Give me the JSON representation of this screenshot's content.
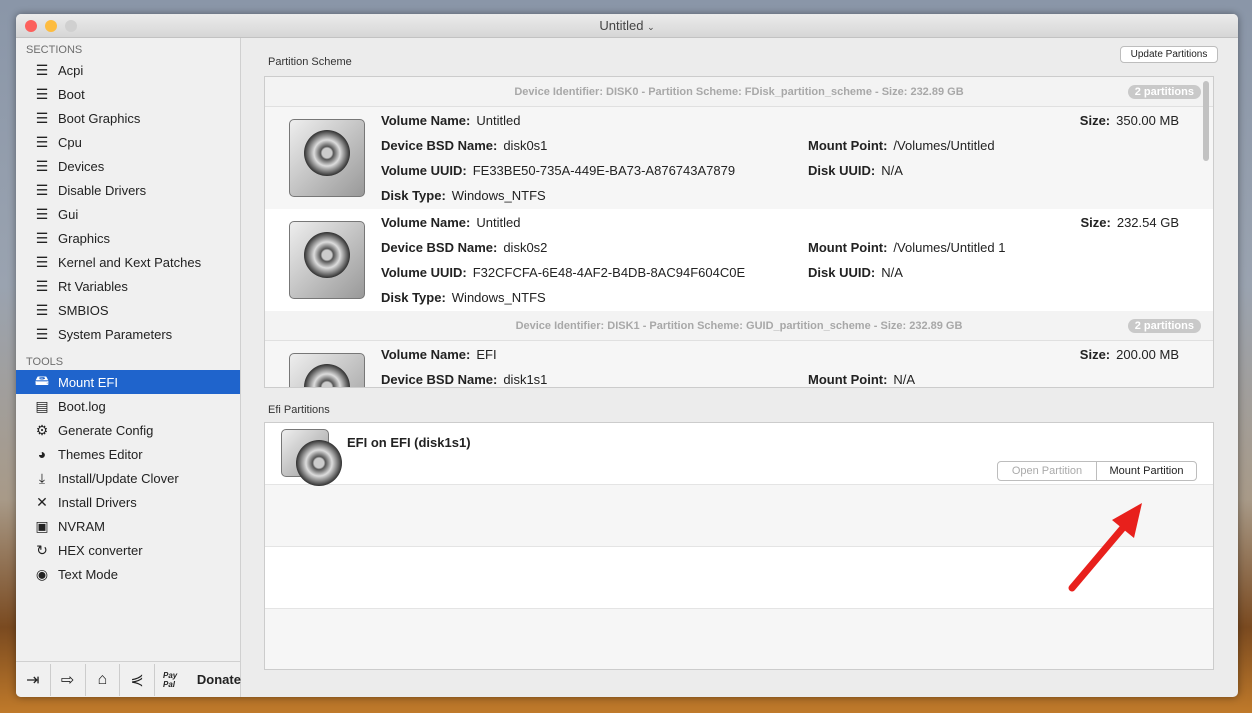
{
  "window": {
    "title": "Untitled"
  },
  "sidebar": {
    "sections_label": "SECTIONS",
    "sections": [
      "Acpi",
      "Boot",
      "Boot Graphics",
      "Cpu",
      "Devices",
      "Disable Drivers",
      "Gui",
      "Graphics",
      "Kernel and Kext Patches",
      "Rt Variables",
      "SMBIOS",
      "System Parameters"
    ],
    "tools_label": "TOOLS",
    "tools": [
      {
        "label": "Mount EFI",
        "icon": "disk-icon",
        "selected": true
      },
      {
        "label": "Boot.log",
        "icon": "log-icon"
      },
      {
        "label": "Generate Config",
        "icon": "gear-icon"
      },
      {
        "label": "Themes Editor",
        "icon": "palette-icon"
      },
      {
        "label": "Install/Update Clover",
        "icon": "download-icon"
      },
      {
        "label": "Install Drivers",
        "icon": "tools-icon"
      },
      {
        "label": "NVRAM",
        "icon": "chip-icon"
      },
      {
        "label": "HEX converter",
        "icon": "refresh-icon"
      },
      {
        "label": "Text Mode",
        "icon": "eye-icon"
      }
    ],
    "donate": {
      "paypal": "Pay Pal",
      "label": "Donate"
    }
  },
  "main": {
    "partition_scheme_label": "Partition Scheme",
    "update_button": "Update Partitions",
    "labels": {
      "volume_name": "Volume Name:",
      "bsd": "Device BSD Name:",
      "uuid": "Volume UUID:",
      "type": "Disk Type:",
      "size": "Size:",
      "mount": "Mount Point:",
      "disk_uuid": "Disk UUID:"
    },
    "devices": [
      {
        "header": "Device Identifier: DISK0 - Partition Scheme: FDisk_partition_scheme - Size: 232.89 GB",
        "badge": "2 partitions",
        "partitions": [
          {
            "volume_name": "Untitled",
            "bsd": "disk0s1",
            "uuid": "FE33BE50-735A-449E-BA73-A876743A7879",
            "type": "Windows_NTFS",
            "size": "350.00 MB",
            "mount": "/Volumes/Untitled",
            "disk_uuid": "N/A"
          },
          {
            "volume_name": "Untitled",
            "bsd": "disk0s2",
            "uuid": "F32CFCFA-6E48-4AF2-B4DB-8AC94F604C0E",
            "type": "Windows_NTFS",
            "size": "232.54 GB",
            "mount": "/Volumes/Untitled 1",
            "disk_uuid": "N/A"
          }
        ]
      },
      {
        "header": "Device Identifier: DISK1 - Partition Scheme: GUID_partition_scheme - Size: 232.89 GB",
        "badge": "2 partitions",
        "partitions": [
          {
            "volume_name": "EFI",
            "bsd": "disk1s1",
            "size": "200.00 MB",
            "mount": "N/A"
          }
        ]
      }
    ],
    "efi_label": "Efi Partitions",
    "efi": {
      "title": "EFI on EFI (disk1s1)",
      "open_button": "Open Partition",
      "mount_button": "Mount Partition"
    }
  }
}
